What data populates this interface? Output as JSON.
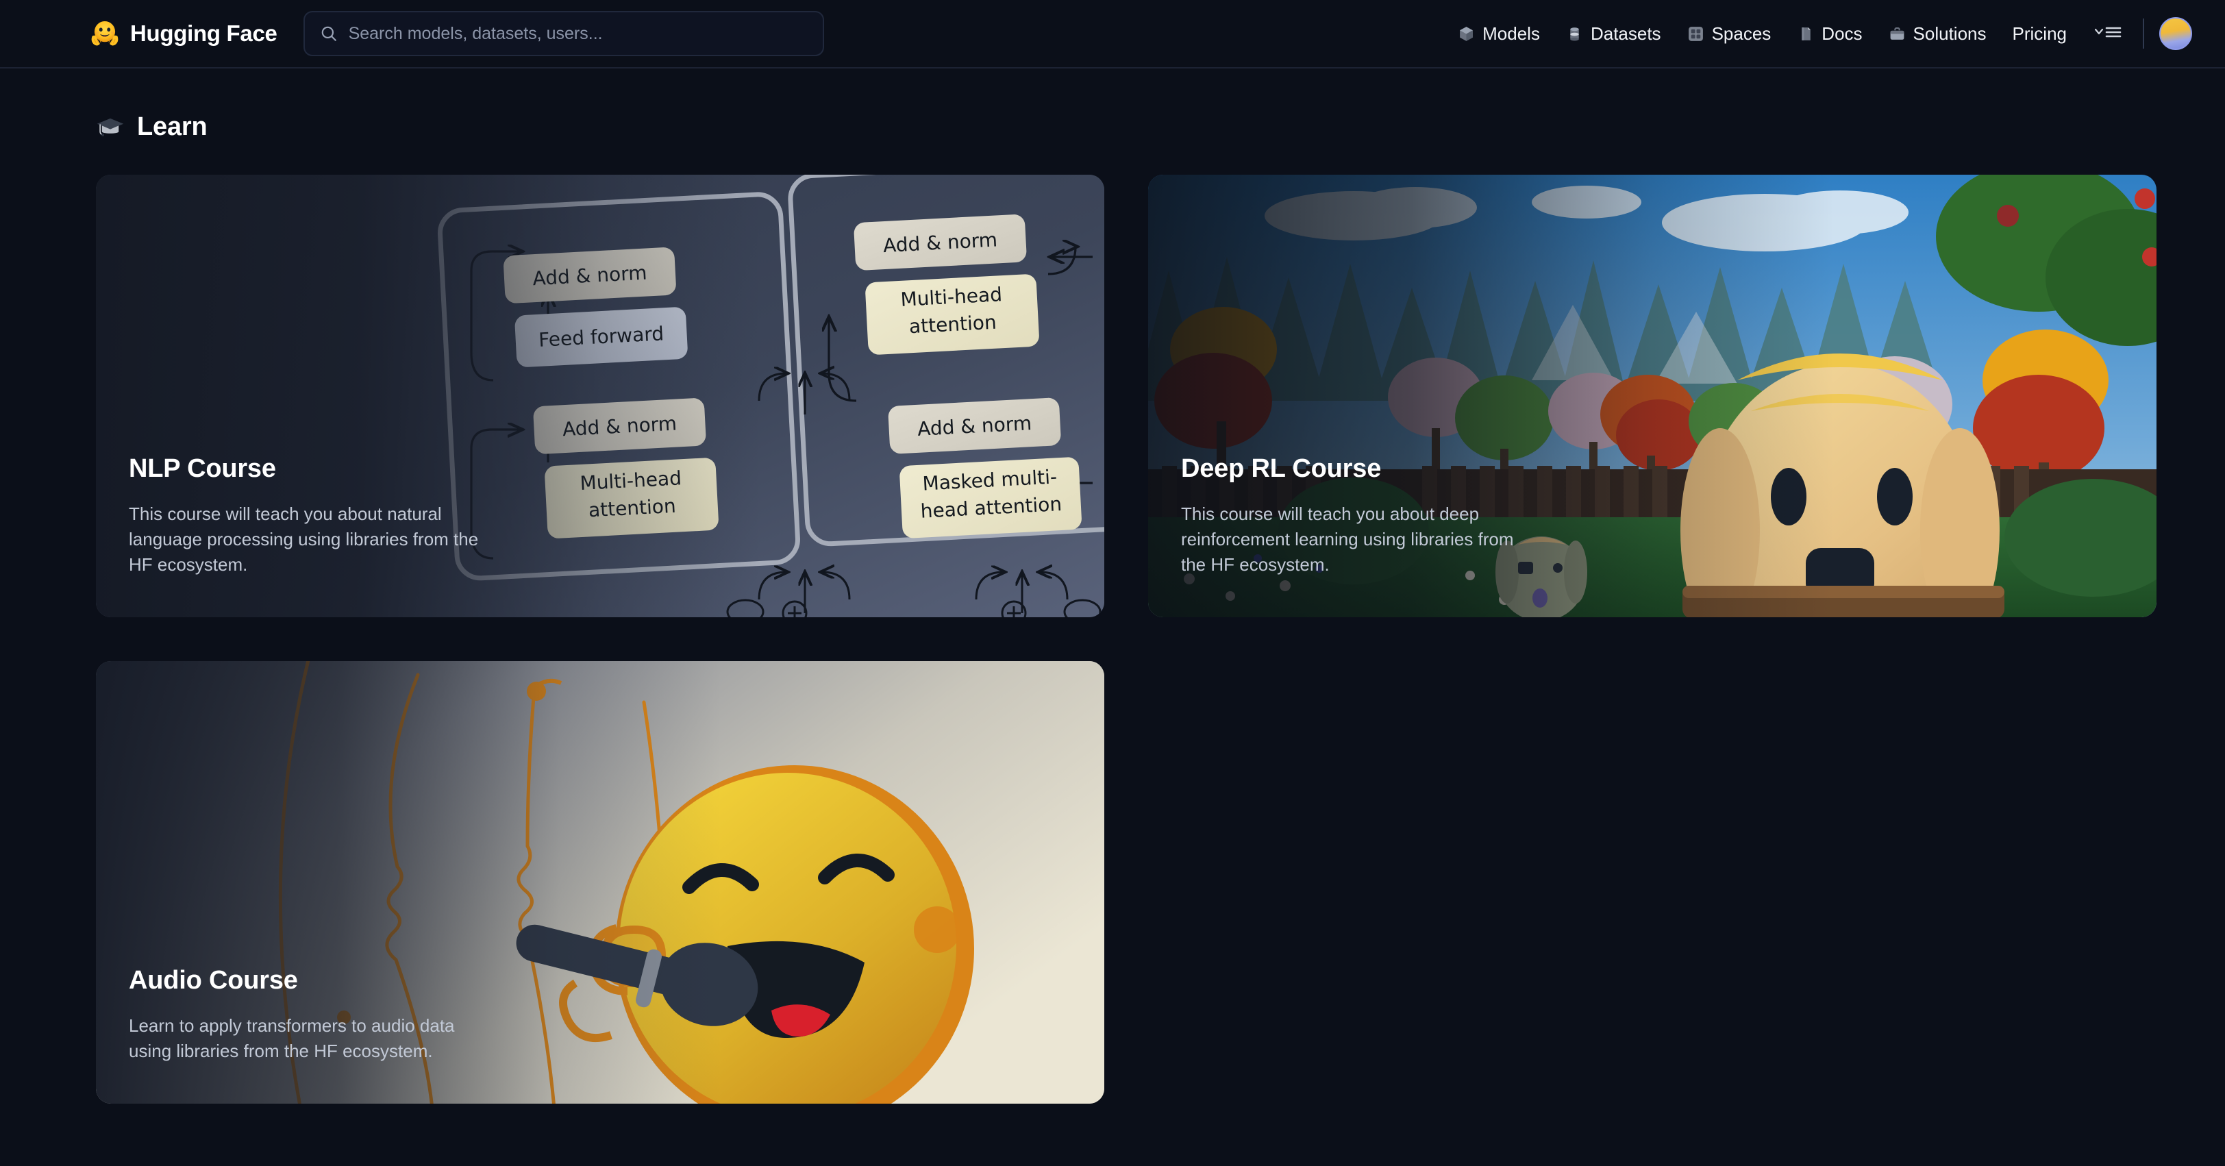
{
  "header": {
    "brand": {
      "name": "Hugging Face",
      "logo_icon": "hugging-face-logo"
    },
    "search": {
      "placeholder": "Search models, datasets, users...",
      "value": "",
      "icon": "search-icon"
    },
    "nav_items": [
      {
        "label": "Models",
        "icon": "cube-icon"
      },
      {
        "label": "Datasets",
        "icon": "database-icon"
      },
      {
        "label": "Spaces",
        "icon": "grid-squares-icon"
      },
      {
        "label": "Docs",
        "icon": "book-icon"
      },
      {
        "label": "Solutions",
        "icon": "briefcase-icon"
      },
      {
        "label": "Pricing",
        "icon": ""
      }
    ],
    "menu_toggle": {
      "icon": "chevron-down-hamburger-icon"
    },
    "avatar": {
      "icon": "user-avatar"
    }
  },
  "page": {
    "title": "Learn",
    "title_icon": "graduation-cap-icon"
  },
  "cards": [
    {
      "id": "nlp-course",
      "title": "NLP Course",
      "description": "This course will teach you about natural language processing using libraries from the HF ecosystem.",
      "art": "transformer-architecture-diagram",
      "diagram_labels": [
        "Add & norm",
        "Feed forward",
        "Add & norm",
        "Multi-head attention",
        "Add & norm",
        "Multi-head attention",
        "Add & norm",
        "Masked multi-head attention"
      ]
    },
    {
      "id": "deep-rl-course",
      "title": "Deep RL Course",
      "description": "This course will teach you about deep reinforcement learning using libraries from the HF ecosystem.",
      "art": "huggy-dog-3d-garden-scene"
    },
    {
      "id": "audio-course",
      "title": "Audio Course",
      "description": "Learn to apply transformers to audio data using libraries from the HF ecosystem.",
      "art": "singing-emoji-with-microphone"
    }
  ],
  "colors": {
    "background": "#0b0f19",
    "header_border": "#1c2233",
    "text_primary": "#ffffff",
    "text_secondary": "#c2c9d6",
    "accent_orange": "#d98418",
    "accent_yellow": "#f4c542"
  }
}
